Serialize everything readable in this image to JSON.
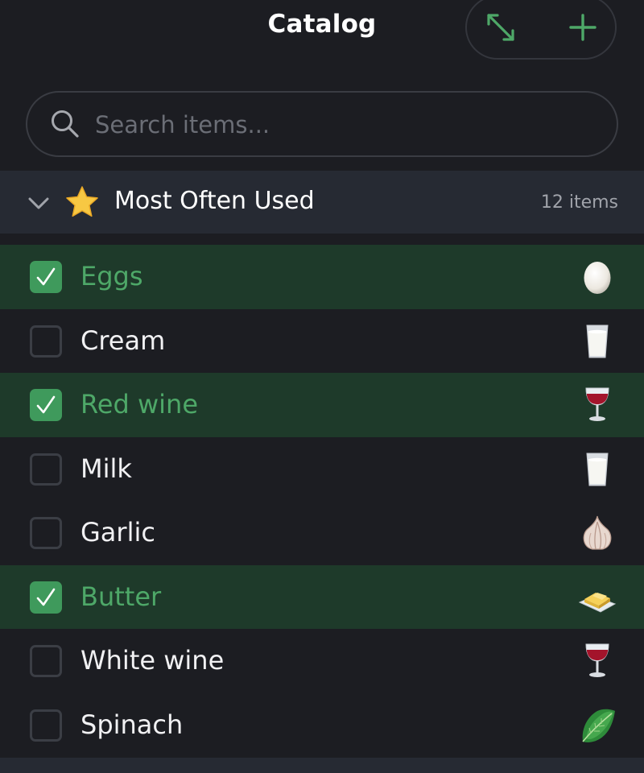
{
  "header": {
    "title": "Catalog"
  },
  "search": {
    "placeholder": "Search items..."
  },
  "section": {
    "title": "Most Often Used",
    "count": "12 items"
  },
  "items": [
    {
      "label": "Eggs",
      "checked": true,
      "icon": "egg-icon"
    },
    {
      "label": "Cream",
      "checked": false,
      "icon": "milk-glass-icon"
    },
    {
      "label": "Red wine",
      "checked": true,
      "icon": "wine-glass-icon"
    },
    {
      "label": "Milk",
      "checked": false,
      "icon": "milk-glass-icon"
    },
    {
      "label": "Garlic",
      "checked": false,
      "icon": "garlic-icon"
    },
    {
      "label": "Butter",
      "checked": true,
      "icon": "butter-icon"
    },
    {
      "label": "White wine",
      "checked": false,
      "icon": "wine-glass-icon"
    },
    {
      "label": "Spinach",
      "checked": false,
      "icon": "leafy-green-icon"
    }
  ],
  "colors": {
    "accent": "#3f9a5c",
    "checked_row": "#1e3a2a",
    "background": "#1c1d22"
  }
}
